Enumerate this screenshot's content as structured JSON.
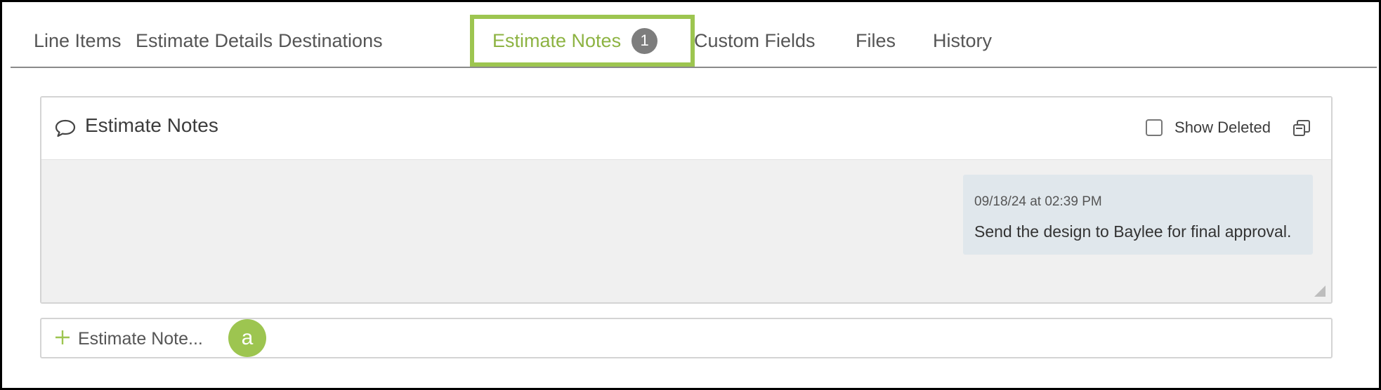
{
  "tabs": [
    {
      "label": "Line Items"
    },
    {
      "label": "Estimate Details"
    },
    {
      "label": "Destinations"
    },
    {
      "label": "Estimate Notes",
      "badge": "1",
      "active": true
    },
    {
      "label": "Custom Fields"
    },
    {
      "label": "Files"
    },
    {
      "label": "History"
    }
  ],
  "panel": {
    "title": "Estimate Notes",
    "title_icon": "comment-icon",
    "show_deleted_label": "Show Deleted",
    "show_deleted_checked": false,
    "expand_icon": "expand-icon"
  },
  "notes": [
    {
      "timestamp": "09/18/24 at 02:39 PM",
      "text": "Send the design to Baylee for final approval."
    }
  ],
  "add_note": {
    "placeholder": "Estimate Note...",
    "icon": "plus-icon"
  },
  "callout": {
    "label": "a"
  },
  "colors": {
    "accent": "#9dc550",
    "active_tab_text": "#8db342",
    "badge": "#7d7d7d",
    "note_bubble": "#e0e7ec",
    "panel_body": "#f0f0f0"
  }
}
